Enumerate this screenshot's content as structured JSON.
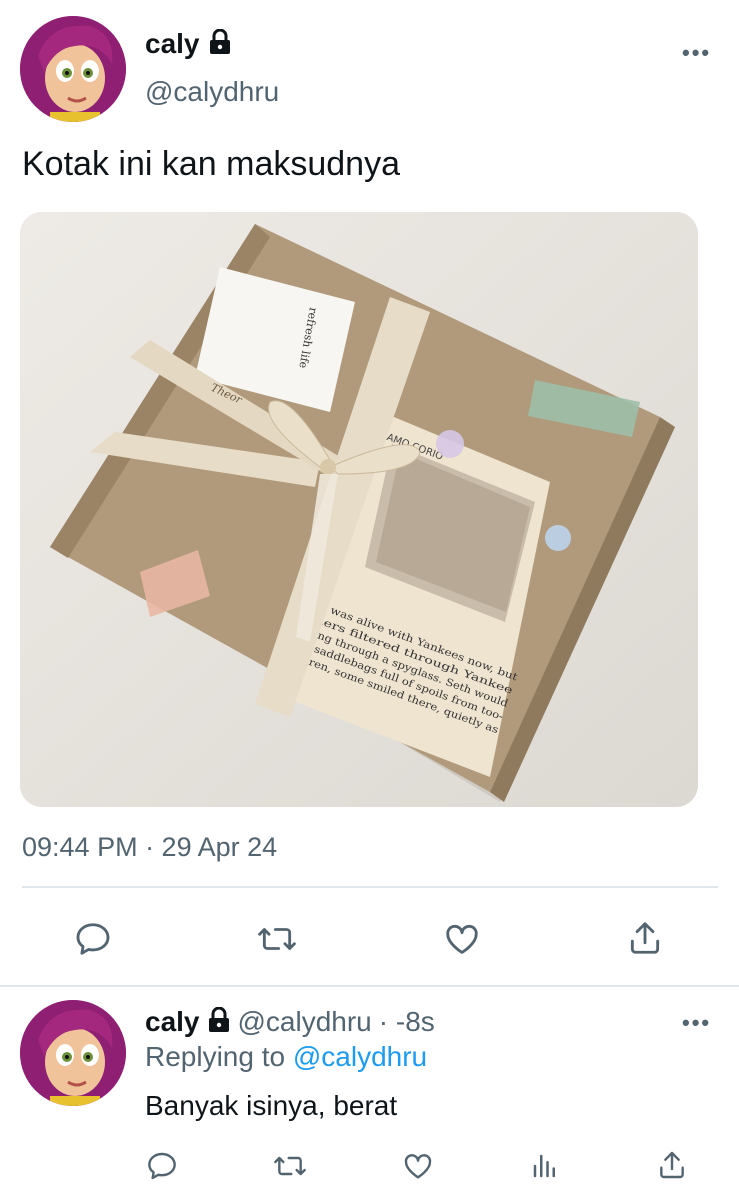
{
  "main_tweet": {
    "display_name": "caly",
    "handle": "@calydhru",
    "text": "Kotak ini kan maksudnya",
    "timestamp": "09:44 PM · 29 Apr 24",
    "more_label": "•••"
  },
  "photo": {
    "card_label": "refresh life",
    "ribbon_text": "Theor",
    "postcard_text": "POLIAMO CORIO",
    "page_text": "area was alive with Yankees now, but raiders filtered through Yankee looking through a spyglass. Seth would with saddlebags full of spoils from too- children, some smiled there, quietly as disappear as silently and quietly as lamp, was situated on a small shed, lamp,"
  },
  "actions": [
    "reply-icon",
    "retweet-icon",
    "like-icon",
    "share-icon"
  ],
  "reply_tweet": {
    "display_name": "caly",
    "handle": "@calydhru",
    "time": "· -8s",
    "replying_prefix": "Replying to",
    "replying_handle": "@calydhru",
    "text": "Banyak isinya, berat",
    "more_label": "•••"
  },
  "reply_actions": [
    "reply-icon",
    "retweet-icon",
    "like-icon",
    "views-icon",
    "share-icon"
  ],
  "colors": {
    "link": "#1d9bf0",
    "secondary": "#536471",
    "divider": "#e1e6ea"
  }
}
